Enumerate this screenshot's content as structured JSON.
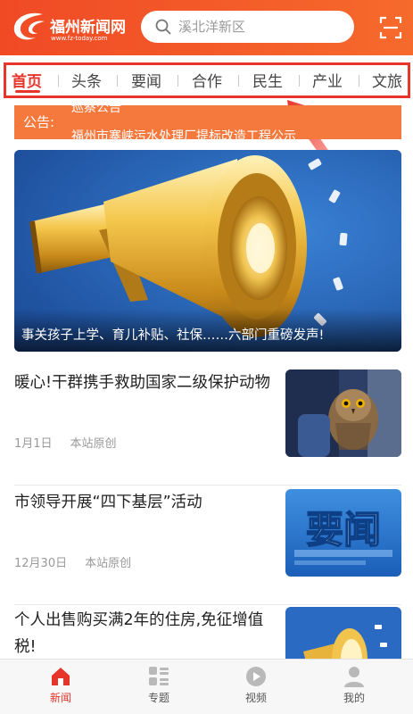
{
  "header": {
    "logo_text": "福州新闻网",
    "logo_url": "www.fz-today.com",
    "search_placeholder": "溪北洋新区"
  },
  "nav": {
    "tabs": [
      "首页",
      "头条",
      "要闻",
      "合作",
      "民生",
      "产业",
      "文旅"
    ],
    "active_index": 0
  },
  "notice": {
    "label": "公告:",
    "line1": "巡察公告",
    "line2": "福州市寨峡污水处理厂提标改造工程公示"
  },
  "banner": {
    "caption": "事关孩子上学、育儿补贴、社保……六部门重磅发声!"
  },
  "news": [
    {
      "title": "暖心!干群携手救助国家二级保护动物",
      "date": "1月1日",
      "source": "本站原创"
    },
    {
      "title": "市领导开展“四下基层”活动",
      "date": "12月30日",
      "source": "本站原创",
      "thumb_text": "要闻"
    },
    {
      "title": "个人出售购买满2年的住房,免征增值税!",
      "date": "",
      "source": ""
    }
  ],
  "tabbar": {
    "items": [
      "新闻",
      "专题",
      "视频",
      "我的"
    ],
    "active_index": 0
  },
  "colors": {
    "brand": "#f04a25",
    "accent_red": "#e8352b",
    "notice_bg": "#f5793d",
    "banner_bg": "#2863b7"
  }
}
